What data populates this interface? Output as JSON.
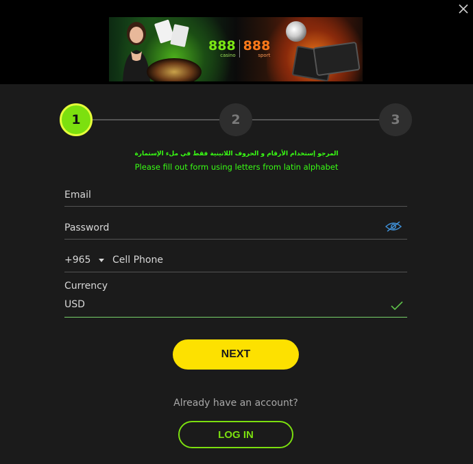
{
  "banner": {
    "logo_casino_number": "888",
    "logo_casino_sub": "casino",
    "logo_sport_number": "888",
    "logo_sport_sub": "sport"
  },
  "stepper": {
    "steps": [
      "1",
      "2",
      "3"
    ],
    "active_step": 1
  },
  "notice": {
    "arabic": "المرجو إستخدام الأرقام و الحروف اللاتينية فقط في ملء الإستمارة",
    "english": "Please fill out form using letters from latin alphabet"
  },
  "form": {
    "email_label": "Email",
    "password_label": "Password",
    "phone_prefix": "+965",
    "phone_label": "Cell Phone",
    "currency_label": "Currency",
    "currency_value": "USD"
  },
  "actions": {
    "next_label": "NEXT",
    "already_text": "Already have an account?",
    "login_label": "LOG IN"
  },
  "colors": {
    "accent_green": "#7ce00f",
    "next_yellow": "#fde100",
    "notice_green": "#39ff14",
    "panel_bg": "#1b1b1b"
  },
  "icons": [
    "close-icon",
    "eye-hidden-icon",
    "chevron-down-icon",
    "checkmark-icon"
  ]
}
